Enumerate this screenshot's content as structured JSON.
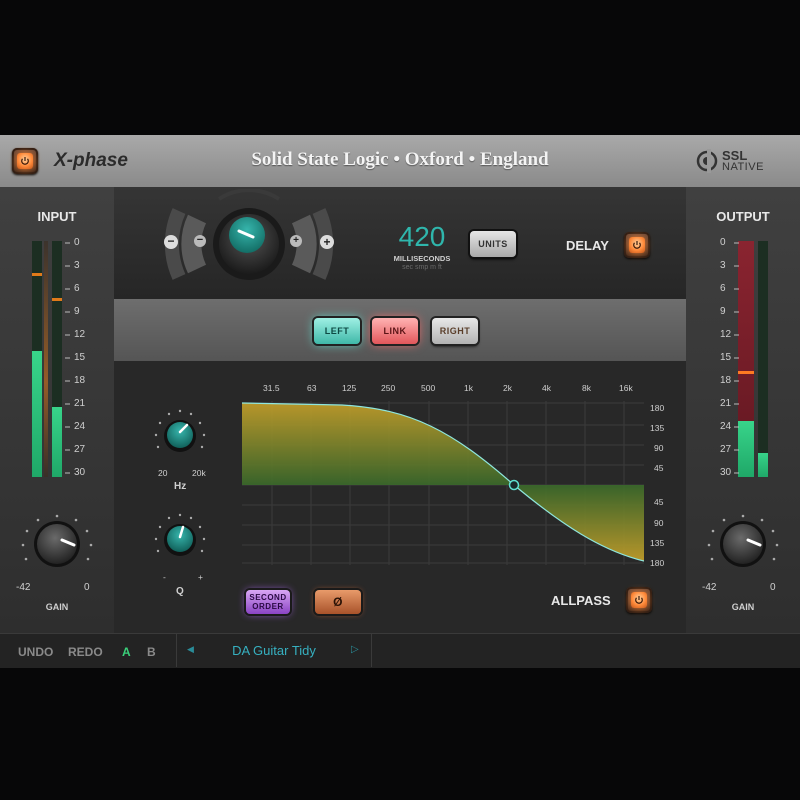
{
  "header": {
    "product_name": "X-phase",
    "brand_line": "Solid State Logic • Oxford • England",
    "logo_top": "SSL",
    "logo_bottom": "NATIVE"
  },
  "input": {
    "title": "INPUT",
    "scale": [
      "0",
      "3",
      "6",
      "9",
      "12",
      "15",
      "18",
      "21",
      "24",
      "27",
      "30"
    ],
    "gain_label": "GAIN",
    "gain_min": "-42",
    "gain_max": "0"
  },
  "output": {
    "title": "OUTPUT",
    "scale": [
      "0",
      "3",
      "6",
      "9",
      "12",
      "15",
      "18",
      "21",
      "24",
      "27",
      "30"
    ],
    "gain_label": "GAIN",
    "gain_min": "-42",
    "gain_max": "0"
  },
  "delay": {
    "value": "420",
    "unit": "MILLISECONDS",
    "unit_options": "sec  smp  m  ft",
    "units_button": "UNITS",
    "label": "DELAY"
  },
  "channel": {
    "left": "LEFT",
    "link": "LINK",
    "right": "RIGHT"
  },
  "filter": {
    "hz_label": "Hz",
    "hz_min": "20",
    "hz_max": "20k",
    "q_label": "Q",
    "q_min": "-",
    "q_max": "+",
    "second_order_1": "SECOND",
    "second_order_2": "ORDER",
    "invert_symbol": "Ø",
    "allpass_label": "ALLPASS",
    "freq_labels": [
      "31.5",
      "63",
      "125",
      "250",
      "500",
      "1k",
      "2k",
      "4k",
      "8k",
      "16k"
    ],
    "phase_labels_top": [
      "180",
      "135",
      "90",
      "45"
    ],
    "phase_labels_bottom": [
      "45",
      "90",
      "135",
      "180"
    ]
  },
  "footer": {
    "undo": "UNDO",
    "redo": "REDO",
    "a": "A",
    "b": "B",
    "preset_name": "DA Guitar Tidy",
    "prev_arrow": "◀",
    "next_arrow": "▷"
  },
  "colors": {
    "accent_teal": "#1fa8a0",
    "meter_green": "#27c47a",
    "meter_orange": "#e07a1a",
    "meter_red": "#7a1e26",
    "power_orange": "#ff8a3a"
  }
}
